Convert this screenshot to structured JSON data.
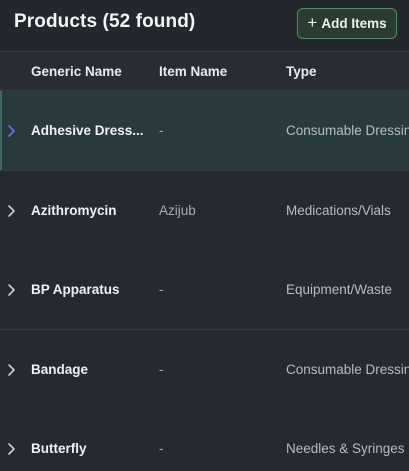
{
  "header": {
    "title": "Products (52 found)",
    "add_button_label": "Add Items",
    "add_button_icon": "plus-icon"
  },
  "table": {
    "columns": {
      "generic_name": "Generic Name",
      "item_name": "Item Name",
      "type": "Type"
    },
    "rows": [
      {
        "generic_name": "Adhesive Dress...",
        "item_name": "-",
        "type": "Consumable Dressings",
        "selected": true
      },
      {
        "generic_name": "Azithromycin",
        "item_name": "Azijub",
        "type": "Medications/Vials",
        "selected": false
      },
      {
        "generic_name": "BP Apparatus",
        "item_name": "-",
        "type": "Equipment/Waste",
        "selected": false
      },
      {
        "generic_name": "Bandage",
        "item_name": "-",
        "type": "Consumable Dressings",
        "selected": false
      },
      {
        "generic_name": "Butterfly",
        "item_name": "-",
        "type": "Needles & Syringes",
        "selected": false
      }
    ]
  },
  "colors": {
    "background": "#252a30",
    "selected_row": "#293a3d",
    "accent_green": "#4c8f64",
    "chevron_selected": "#7e6cf0",
    "chevron": "#c9ced4"
  }
}
